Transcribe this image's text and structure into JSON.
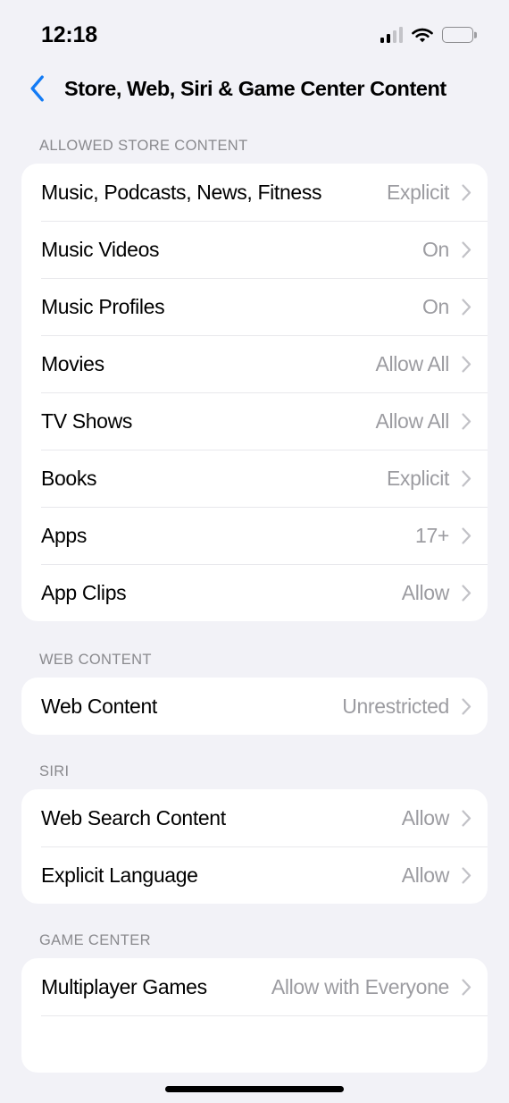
{
  "status_bar": {
    "time": "12:18",
    "signal_icon": "cellular-signal-icon",
    "wifi_icon": "wifi-icon",
    "battery_icon": "battery-icon",
    "signal_bars_filled": 2,
    "signal_bars_total": 4,
    "battery_level_percent": 95
  },
  "nav": {
    "back_icon": "chevron-left-icon",
    "title": "Store, Web, Siri & Game Center Content"
  },
  "colors": {
    "accent_blue": "#137BF5",
    "page_background": "#f2f2f7",
    "card_background": "#ffffff",
    "secondary_text": "#9c9ca1",
    "section_header_text": "#8a8a8e",
    "separator": "#e8e8ec"
  },
  "sections": [
    {
      "header": "ALLOWED STORE CONTENT",
      "rows": [
        {
          "label": "Music, Podcasts, News, Fitness",
          "value": "Explicit"
        },
        {
          "label": "Music Videos",
          "value": "On"
        },
        {
          "label": "Music Profiles",
          "value": "On"
        },
        {
          "label": "Movies",
          "value": "Allow All"
        },
        {
          "label": "TV Shows",
          "value": "Allow All"
        },
        {
          "label": "Books",
          "value": "Explicit"
        },
        {
          "label": "Apps",
          "value": "17+"
        },
        {
          "label": "App Clips",
          "value": "Allow"
        }
      ]
    },
    {
      "header": "WEB CONTENT",
      "rows": [
        {
          "label": "Web Content",
          "value": "Unrestricted"
        }
      ]
    },
    {
      "header": "SIRI",
      "rows": [
        {
          "label": "Web Search Content",
          "value": "Allow"
        },
        {
          "label": "Explicit Language",
          "value": "Allow"
        }
      ]
    },
    {
      "header": "GAME CENTER",
      "rows": [
        {
          "label": "Multiplayer Games",
          "value": "Allow with Everyone"
        }
      ]
    }
  ],
  "home_indicator": "home-indicator"
}
